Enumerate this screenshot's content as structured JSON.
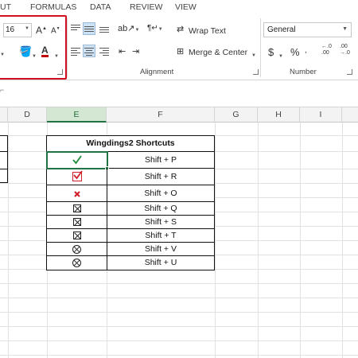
{
  "menu": {
    "tabs": [
      "UT",
      "FORMULAS",
      "DATA",
      "REVIEW",
      "VIEW"
    ]
  },
  "ribbon": {
    "font_size": "16",
    "wrap_text": "Wrap Text",
    "merge_center": "Merge & Center",
    "number_format": "General",
    "alignment_label": "Alignment",
    "number_label": "Number",
    "currency": "$",
    "percent": "%"
  },
  "columns": [
    "D",
    "E",
    "F",
    "G",
    "H",
    "I"
  ],
  "selected_column": "E",
  "table": {
    "title": "Wingdings2 Shortcuts",
    "rows": [
      {
        "symbol": "check-green",
        "shortcut": "Shift + P"
      },
      {
        "symbol": "checkbox-red",
        "shortcut": "Shift + R"
      },
      {
        "symbol": "x-red",
        "shortcut": "Shift + O"
      },
      {
        "symbol": "box-x",
        "shortcut": "Shift + Q"
      },
      {
        "symbol": "box-x",
        "shortcut": "Shift + S"
      },
      {
        "symbol": "box-x",
        "shortcut": "Shift + T"
      },
      {
        "symbol": "circle-x",
        "shortcut": "Shift + V"
      },
      {
        "symbol": "circle-x",
        "shortcut": "Shift + U"
      }
    ]
  },
  "colors": {
    "accent_green": "#217346",
    "highlight_red": "#d01020"
  }
}
